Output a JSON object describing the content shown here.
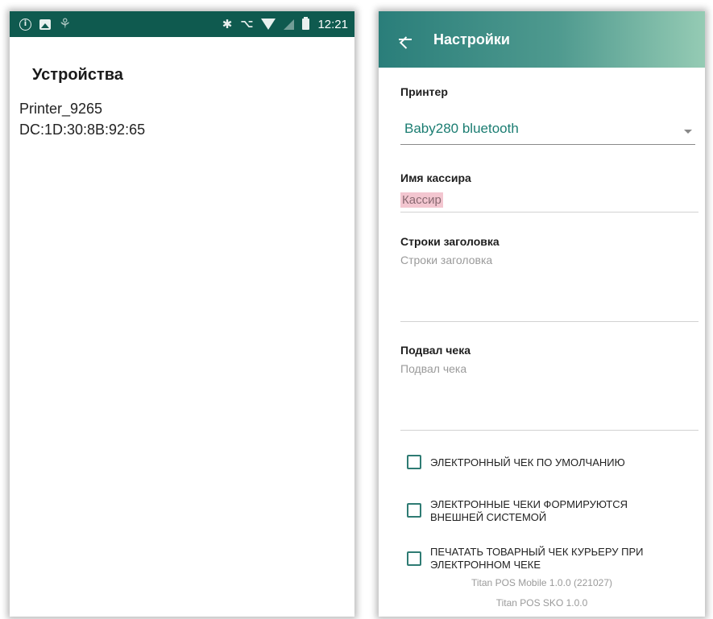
{
  "left_screen": {
    "status_bar": {
      "time": "12:21",
      "left_icons": [
        "info-icon",
        "image-icon",
        "fingerprint-icon"
      ],
      "right_icons": [
        "bluetooth-icon",
        "vpn-key-icon",
        "wifi-icon",
        "signal-icon",
        "battery-icon"
      ],
      "background": "#0f5a4f"
    },
    "title": "Устройства",
    "devices": [
      {
        "name": "Printer_9265",
        "mac": "DC:1D:30:8B:92:65"
      }
    ]
  },
  "right_screen": {
    "app_bar": {
      "back_icon": "arrow-back-icon",
      "title": "Настройки",
      "gradient": [
        "#2a7e7a",
        "#95cbb4"
      ]
    },
    "printer": {
      "label": "Принтер",
      "selected": "Baby280 bluetooth",
      "accent": "#1b7d72"
    },
    "cashier": {
      "label": "Имя кассира",
      "value": "Кассир"
    },
    "header_lines": {
      "label": "Строки заголовка",
      "placeholder": "Строки заголовка"
    },
    "receipt_footer": {
      "label": "Подвал чека",
      "placeholder": "Подвал чека"
    },
    "checkboxes": [
      {
        "label": "ЭЛЕКТРОННЫЙ ЧЕК ПО УМОЛЧАНИЮ",
        "checked": false
      },
      {
        "label": "ЭЛЕКТРОННЫЕ ЧЕКИ ФОРМИРУЮТСЯ ВНЕШНЕЙ СИСТЕМОЙ",
        "checked": false
      },
      {
        "label": "ПЕЧАТАТЬ ТОВАРНЫЙ ЧЕК КУРЬЕРУ ПРИ ЭЛЕКТРОННОМ ЧЕКЕ",
        "checked": false
      }
    ],
    "footer": {
      "app_version": "Titan POS Mobile 1.0.0 (221027)",
      "sko_version": "Titan POS SKO 1.0.0"
    }
  }
}
